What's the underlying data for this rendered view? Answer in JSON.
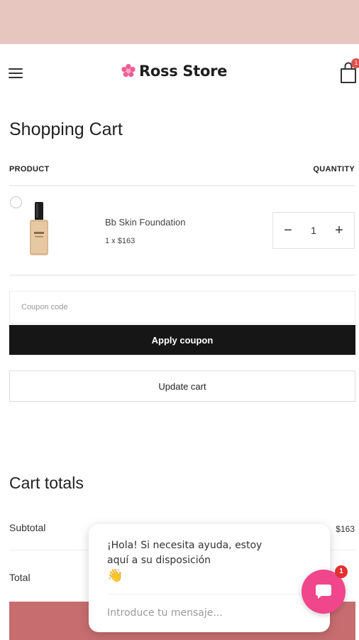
{
  "header": {
    "store_name": "Ross Store",
    "cart_count": "1",
    "logo_icon": "flower-logo-icon",
    "menu_icon": "hamburger-menu-icon",
    "cart_icon": "shopping-bag-icon"
  },
  "colors": {
    "topbar": "#e6c6bf",
    "accent": "#f0468b",
    "checkout": "#c76d6f",
    "apply_button": "#161616"
  },
  "cart": {
    "title": "Shopping Cart",
    "columns": {
      "product": "PRODUCT",
      "quantity": "QUANTITY"
    },
    "items": [
      {
        "name": "Bb Skin Foundation",
        "price_line": "1 x $163",
        "quantity": "1"
      }
    ],
    "qty_decrease": "−",
    "qty_increase": "+",
    "coupon_placeholder": "Coupon code",
    "apply_label": "Apply coupon",
    "update_label": "Update cart"
  },
  "totals": {
    "title": "Cart totals",
    "subtotal_label": "Subtotal",
    "subtotal_value": "$163",
    "total_label": "Total"
  },
  "chat": {
    "greeting": "¡Hola! Si necesita ayuda, estoy aquí a su disposición",
    "wave_emoji": "👋",
    "input_placeholder": "Introduce tu mensaje...",
    "unread_count": "1",
    "icon": "chat-bubble-icon"
  }
}
